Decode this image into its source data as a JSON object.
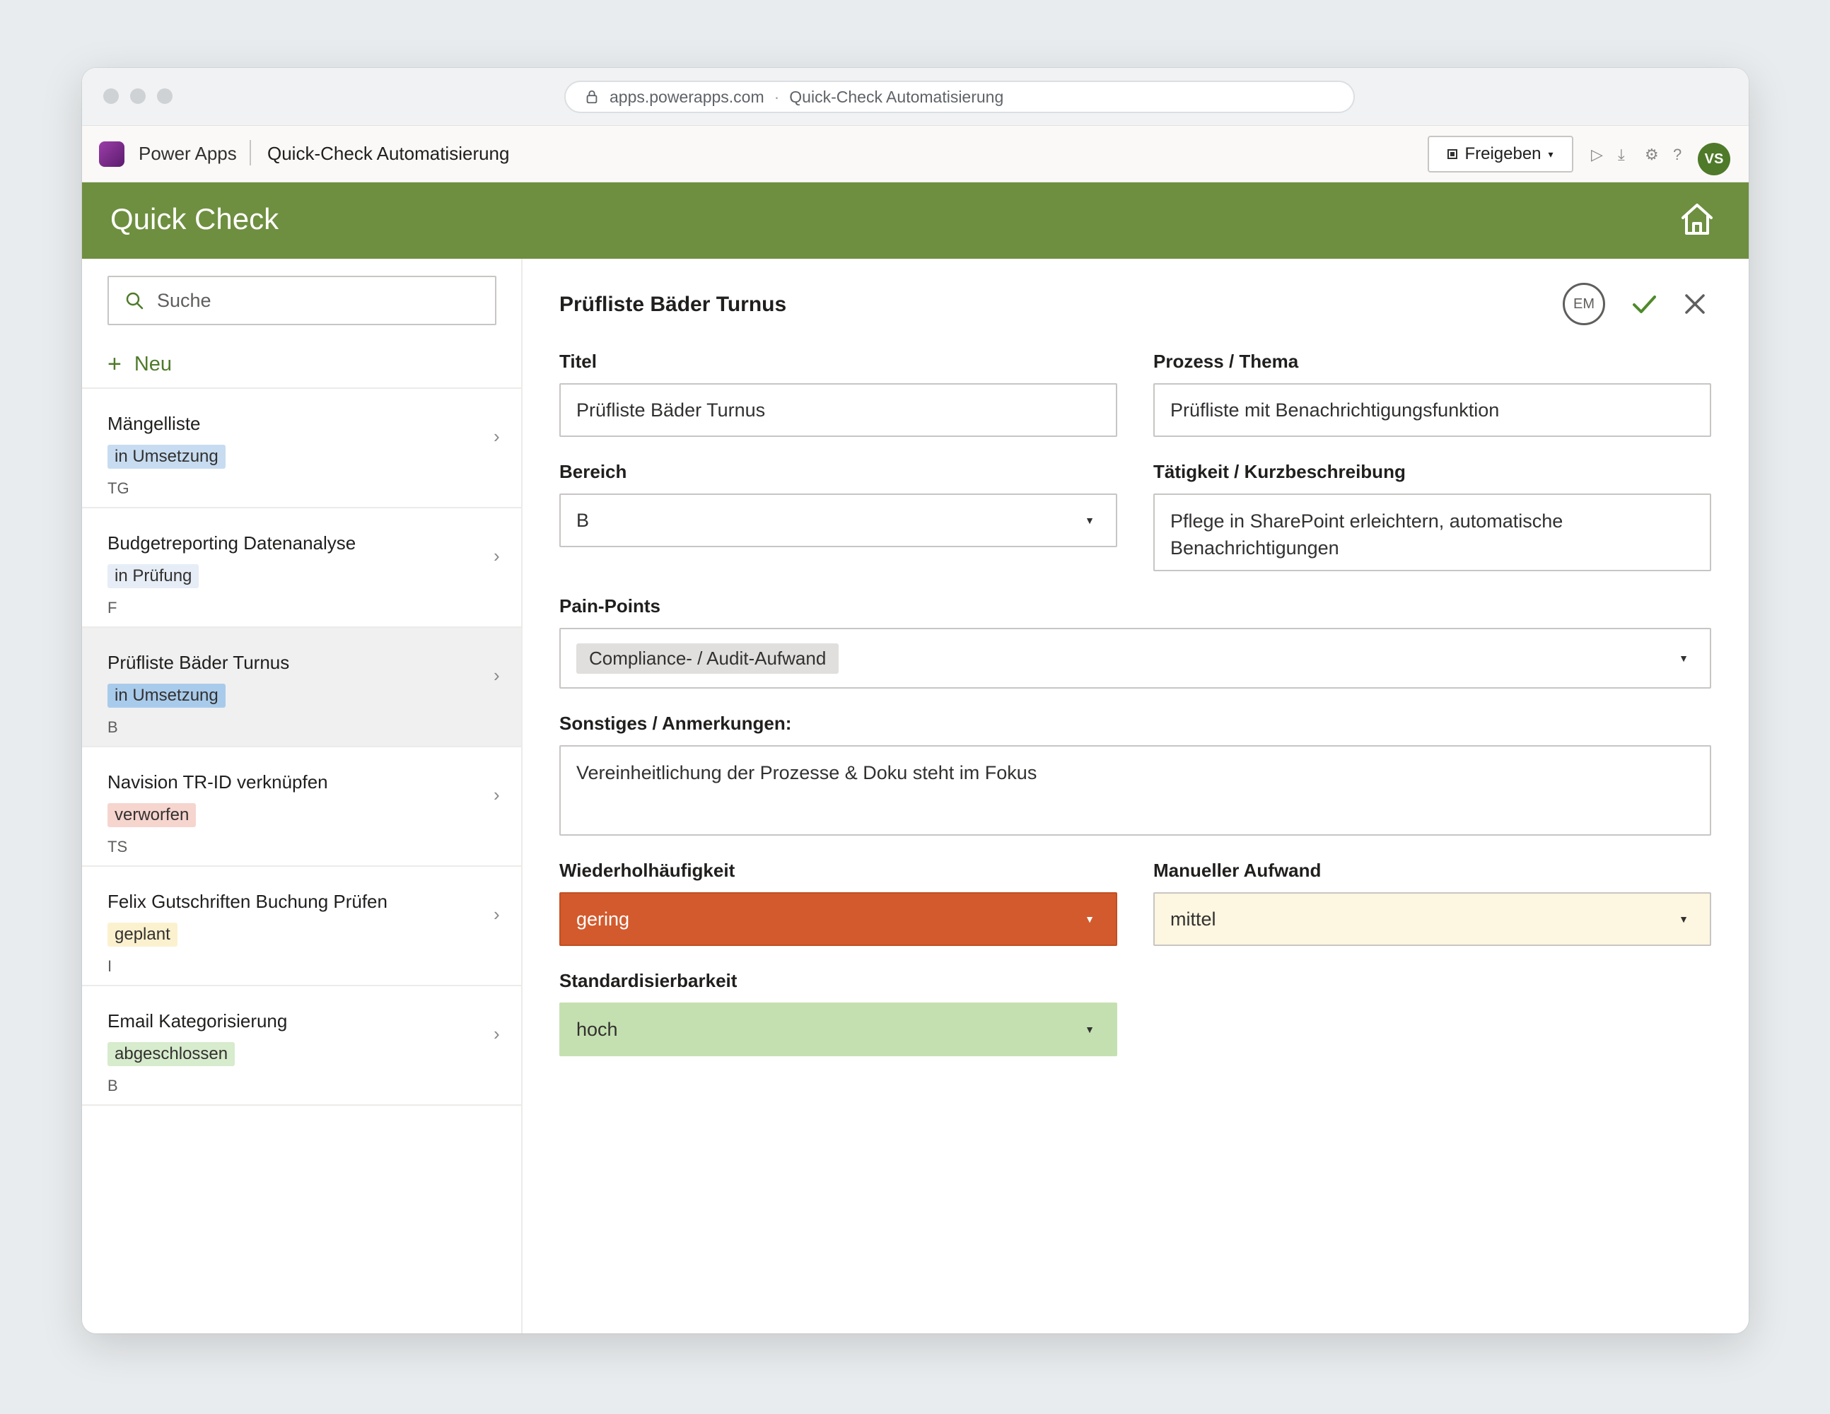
{
  "browser": {
    "url": "apps.powerapps.com",
    "separator": "·",
    "page_title": "Quick-Check Automatisierung"
  },
  "appbar": {
    "brand": "Power Apps",
    "app_name": "Quick-Check Automatisierung",
    "share_label": "Freigeben",
    "avatar_initials": "VS",
    "icons": [
      "play-icon",
      "download-icon",
      "settings-icon",
      "help-icon"
    ]
  },
  "header": {
    "title": "Quick Check",
    "color": "#6e8f3f"
  },
  "sidebar": {
    "search_placeholder": "Suche",
    "new_label": "Neu",
    "items": [
      {
        "title": "Mängelliste",
        "status": "in Umsetzung",
        "status_color": "#c7dcf0",
        "code": "TG"
      },
      {
        "title": "Budgetreporting Datenanalyse",
        "status": "in Prüfung",
        "status_color": "#e6edf6",
        "code": "F"
      },
      {
        "title": "Prüfliste Bäder Turnus",
        "status": "in Umsetzung",
        "status_color": "#a9cbeb",
        "code": "B"
      },
      {
        "title": "Navision TR-ID verknüpfen",
        "status": "verworfen",
        "status_color": "#f6d5cf",
        "code": "TS"
      },
      {
        "title": "Felix Gutschriften Buchung Prüfen",
        "status": "geplant",
        "status_color": "#fcf1cf",
        "code": "I"
      },
      {
        "title": "Email Kategorisierung",
        "status": "abgeschlossen",
        "status_color": "#d7ebcd",
        "code": "B"
      }
    ]
  },
  "form": {
    "title": "Prüfliste Bäder Turnus",
    "em_badge": "EM",
    "fields": {
      "titel_label": "Titel",
      "titel_value": "Prüfliste Bäder Turnus",
      "prozess_label": "Prozess / Thema",
      "prozess_value": "Prüfliste mit Benachrichtigungsfunktion",
      "bereich_label": "Bereich",
      "bereich_value": "B",
      "taetigkeit_label": "Tätigkeit / Kurzbeschreibung",
      "taetigkeit_value": "Pflege in SharePoint erleichtern, automatische Benachrichtigungen",
      "painpoints_label": "Pain-Points",
      "painpoints_chip": "Compliance- / Audit-Aufwand",
      "sonstiges_label": "Sonstiges / Anmerkungen:",
      "sonstiges_value": "Vereinheitlichung der Prozesse & Doku steht im Fokus",
      "wiederhol_label": "Wiederholhäufigkeit",
      "wiederhol_value": "gering",
      "wiederhol_color": "#d35a2c",
      "manuell_label": "Manueller Aufwand",
      "manuell_value": "mittel",
      "manuell_color": "#fdf6e0",
      "standard_label": "Standardisierbarkeit",
      "standard_value": "hoch",
      "standard_color": "#c5e0b0"
    }
  }
}
